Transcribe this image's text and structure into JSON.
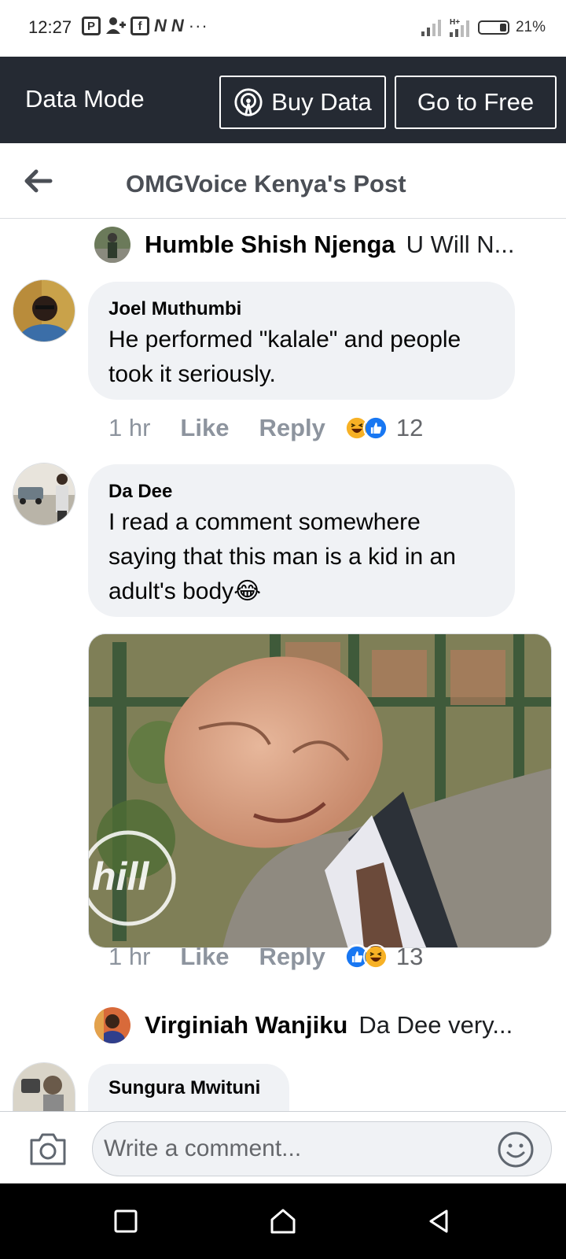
{
  "status_bar": {
    "time": "12:27",
    "notif_icons": [
      "parking-icon",
      "add-person-icon",
      "facebook-icon",
      "n-icon",
      "n-icon"
    ],
    "overflow": "···",
    "battery": "21%"
  },
  "data_mode": {
    "label": "Data Mode",
    "buy_label": "Buy Data",
    "free_label": "Go to Free"
  },
  "header": {
    "title": "OMGVoice Kenya's Post"
  },
  "reply_previews": [
    {
      "name": "Humble Shish Njenga",
      "text": "U Will N..."
    },
    {
      "name": "Virginiah Wanjiku",
      "text": "Da Dee very..."
    }
  ],
  "comments": [
    {
      "author": "Joel Muthumbi",
      "lines": [
        "He performed \"kalale\" and people",
        "took it seriously."
      ],
      "time": "1 hr",
      "like": "Like",
      "reply": "Reply",
      "reactions": [
        "haha",
        "like"
      ],
      "count": "12"
    },
    {
      "author": "Da Dee",
      "lines": [
        "I read a comment somewhere",
        "saying that this man is a kid in an",
        "adult's body"
      ],
      "emoji": "😂",
      "time": "1 hr",
      "like": "Like",
      "reply": "Reply",
      "reactions": [
        "like",
        "haha"
      ],
      "count": "13"
    },
    {
      "author": "Sungura Mwituni"
    }
  ],
  "composer": {
    "placeholder": "Write a comment..."
  },
  "colors": {
    "data_bar": "#252a33",
    "bubble": "#f0f2f5",
    "like_blue": "#1877f2",
    "haha_yellow": "#f7b125",
    "meta_gray": "#8d949e"
  }
}
